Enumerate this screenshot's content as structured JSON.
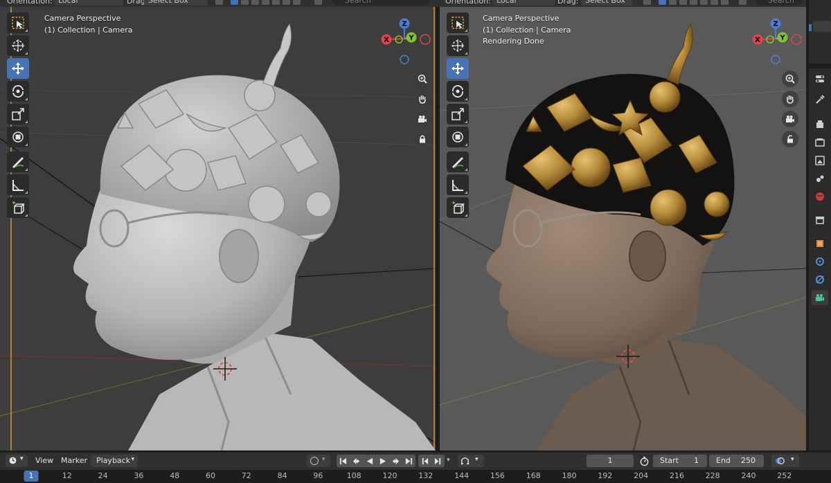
{
  "header": {
    "orientation_label": "Orientation:",
    "orientation_value": "Local",
    "drag_label": "Drag:",
    "drag_value": "Select Box",
    "search_placeholder": "Search"
  },
  "viewports": {
    "left": {
      "overlay_lines": [
        "Camera Perspective",
        "(1) Collection | Camera"
      ]
    },
    "right": {
      "overlay_lines": [
        "Camera Perspective",
        "(1) Collection | Camera",
        "Rendering Done"
      ]
    }
  },
  "tools": [
    {
      "name": "select-box-tool",
      "icon": "select-box-icon"
    },
    {
      "name": "cursor-tool",
      "icon": "cursor-icon"
    },
    {
      "name": "move-tool",
      "icon": "move-icon",
      "active": true
    },
    {
      "name": "rotate-tool",
      "icon": "rotate-icon"
    },
    {
      "name": "scale-tool",
      "icon": "scale-icon"
    },
    {
      "name": "transform-tool",
      "icon": "transform-icon"
    },
    {
      "name": "annotate-tool",
      "icon": "annotate-icon"
    },
    {
      "name": "measure-tool",
      "icon": "measure-icon"
    },
    {
      "name": "add-cube-tool",
      "icon": "add-cube-icon"
    }
  ],
  "gizmo": {
    "z": "Z",
    "y": "Y",
    "x": "X"
  },
  "timeline": {
    "view": "View",
    "marker": "Marker",
    "playback": "Playback",
    "current_frame": "1",
    "start_label": "Start",
    "start_value": "1",
    "end_label": "End",
    "end_value": "250",
    "ruler_ticks": [
      "1",
      "12",
      "24",
      "36",
      "48",
      "60",
      "72",
      "84",
      "96",
      "108",
      "120",
      "132",
      "144",
      "156",
      "168",
      "180",
      "192",
      "204",
      "216",
      "228",
      "240",
      "252"
    ],
    "current_tick": "1"
  },
  "colors": {
    "accent": "#4772b3",
    "axis_x": "#e0434b",
    "axis_y": "#7fc42e",
    "axis_z": "#4b7fd6",
    "bronze": "#b58a3a",
    "skin_render": "#8a7464",
    "clay": "#bdbdbd"
  }
}
